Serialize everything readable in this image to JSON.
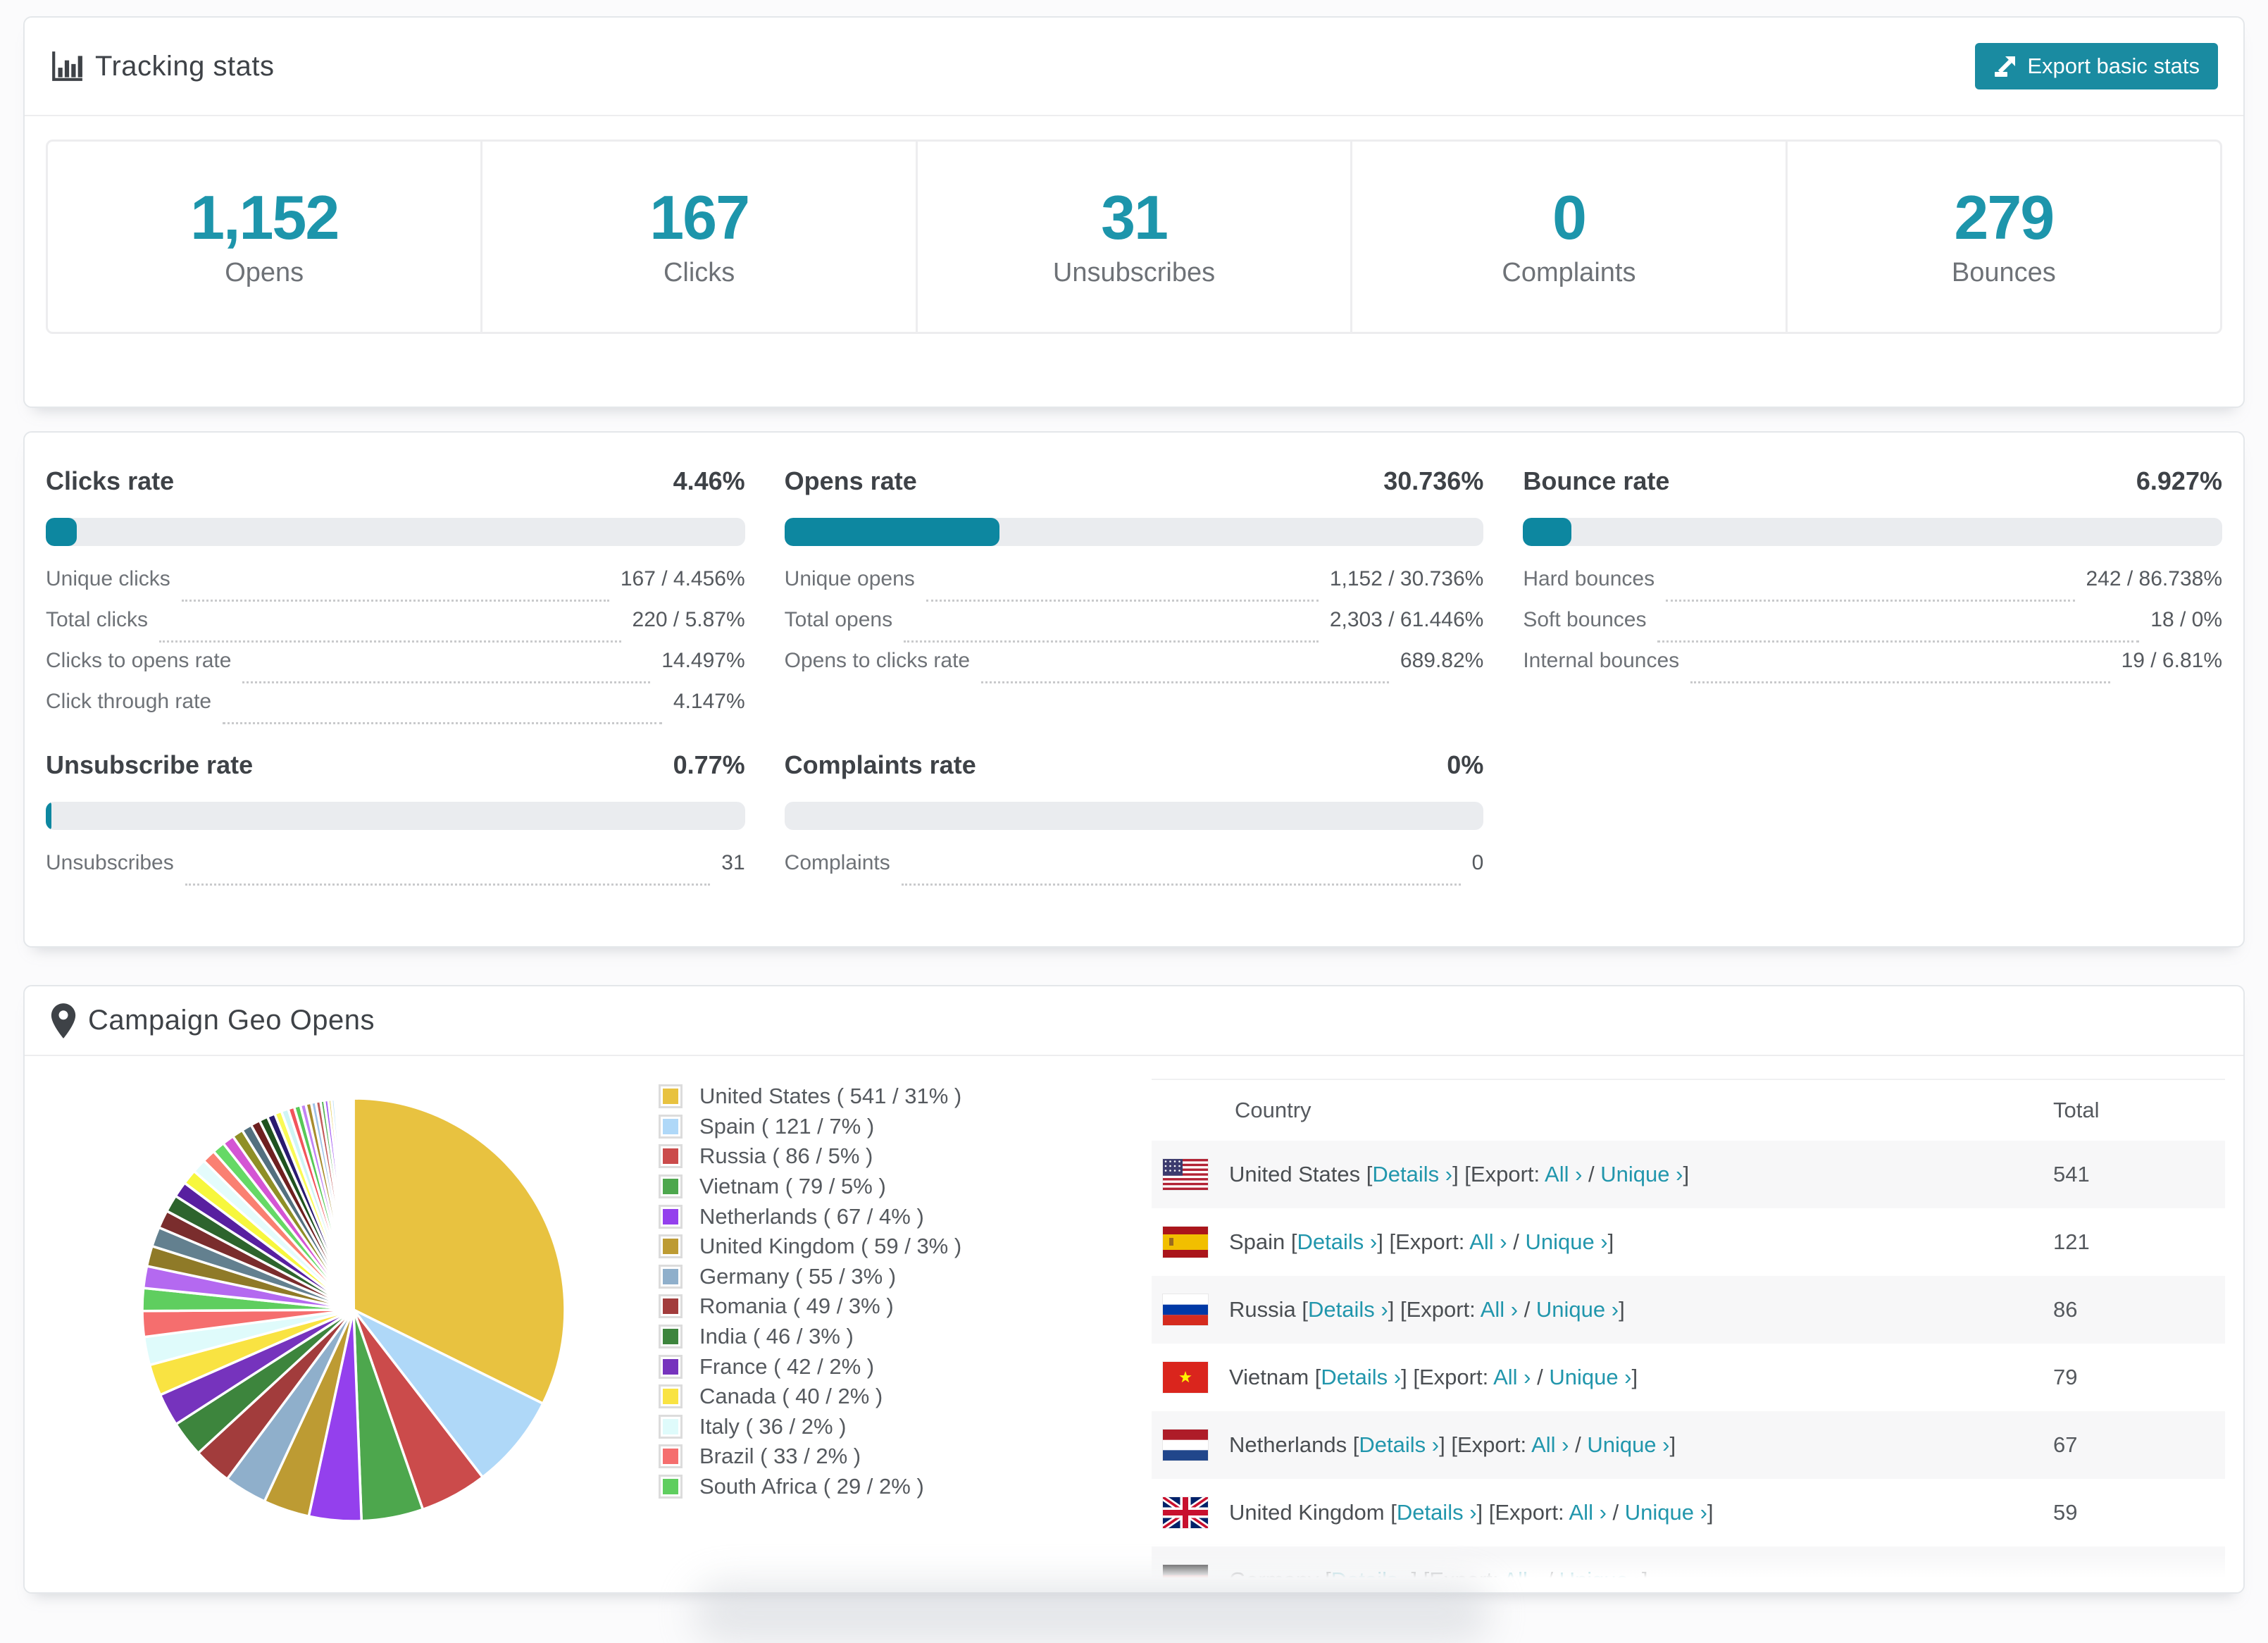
{
  "accent": {
    "teal_number": "#1d95ab",
    "teal_button": "#1a8ba1",
    "teal_link": "#2196ac",
    "bar_fill": "#0d87a0"
  },
  "tracking": {
    "title": "Tracking stats",
    "export_button": "Export basic stats",
    "stats": [
      {
        "value": "1,152",
        "label": "Opens"
      },
      {
        "value": "167",
        "label": "Clicks"
      },
      {
        "value": "31",
        "label": "Unsubscribes"
      },
      {
        "value": "0",
        "label": "Complaints"
      },
      {
        "value": "279",
        "label": "Bounces"
      }
    ]
  },
  "rates": {
    "blocks": [
      {
        "title": "Clicks rate",
        "value": "4.46%",
        "pct": 4.46,
        "rows": [
          {
            "label": "Unique clicks",
            "value": "167 / 4.456%"
          },
          {
            "label": "Total clicks",
            "value": "220 / 5.87%"
          },
          {
            "label": "Clicks to opens rate",
            "value": "14.497%"
          },
          {
            "label": "Click through rate",
            "value": "4.147%"
          }
        ]
      },
      {
        "title": "Opens rate",
        "value": "30.736%",
        "pct": 30.736,
        "rows": [
          {
            "label": "Unique opens",
            "value": "1,152 / 30.736%"
          },
          {
            "label": "Total opens",
            "value": "2,303 / 61.446%"
          },
          {
            "label": "Opens to clicks rate",
            "value": "689.82%"
          }
        ]
      },
      {
        "title": "Bounce rate",
        "value": "6.927%",
        "pct": 6.927,
        "rows": [
          {
            "label": "Hard bounces",
            "value": "242 / 86.738%"
          },
          {
            "label": "Soft bounces",
            "value": "18 / 0%"
          },
          {
            "label": "Internal bounces",
            "value": "19 / 6.81%"
          }
        ]
      },
      {
        "title": "Unsubscribe rate",
        "value": "0.77%",
        "pct": 0.77,
        "rows": [
          {
            "label": "Unsubscribes",
            "value": "31"
          }
        ]
      },
      {
        "title": "Complaints rate",
        "value": "0%",
        "pct": 0,
        "rows": [
          {
            "label": "Complaints",
            "value": "0"
          }
        ]
      }
    ]
  },
  "geo": {
    "title": "Campaign Geo Opens",
    "chart_data": {
      "type": "pie",
      "title": "Campaign Geo Opens",
      "legend_position": "right",
      "start_angle_deg": -90,
      "direction": "clockwise",
      "legend": [
        {
          "label": "United States ( 541 / 31% )",
          "country": "United States",
          "value": 541,
          "percent": 31,
          "color": "#E8C240"
        },
        {
          "label": "Spain ( 121 / 7% )",
          "country": "Spain",
          "value": 121,
          "percent": 7,
          "color": "#AFD8F8"
        },
        {
          "label": "Russia ( 86 / 5% )",
          "country": "Russia",
          "value": 86,
          "percent": 5,
          "color": "#CB4B4B"
        },
        {
          "label": "Vietnam ( 79 / 5% )",
          "country": "Vietnam",
          "value": 79,
          "percent": 5,
          "color": "#4DA74D"
        },
        {
          "label": "Netherlands ( 67 / 4% )",
          "country": "Netherlands",
          "value": 67,
          "percent": 4,
          "color": "#9440ED"
        },
        {
          "label": "United Kingdom ( 59 / 3% )",
          "country": "United Kingdom",
          "value": 59,
          "percent": 3,
          "color": "#BD9B33"
        },
        {
          "label": "Germany ( 55 / 3% )",
          "country": "Germany",
          "value": 55,
          "percent": 3,
          "color": "#8FAFCB"
        },
        {
          "label": "Romania ( 49 / 3% )",
          "country": "Romania",
          "value": 49,
          "percent": 3,
          "color": "#A23C3C"
        },
        {
          "label": "India ( 46 / 3% )",
          "country": "India",
          "value": 46,
          "percent": 3,
          "color": "#3D853D"
        },
        {
          "label": "France ( 42 / 2% )",
          "country": "France",
          "value": 42,
          "percent": 2,
          "color": "#7633BD"
        },
        {
          "label": "Canada ( 40 / 2% )",
          "country": "Canada",
          "value": 40,
          "percent": 2,
          "color": "#F9E342"
        },
        {
          "label": "Italy ( 36 / 2% )",
          "country": "Italy",
          "value": 36,
          "percent": 2,
          "color": "#DFFBFB"
        },
        {
          "label": "Brazil ( 33 / 2% )",
          "country": "Brazil",
          "value": 33,
          "percent": 2,
          "color": "#F56E6E"
        },
        {
          "label": "South Africa ( 29 / 2% )",
          "country": "South Africa",
          "value": 29,
          "percent": 2,
          "color": "#5FCE5F"
        }
      ],
      "estimated_tail": {
        "values": [
          28,
          26,
          25,
          23,
          22,
          20,
          19,
          18,
          17,
          16,
          15,
          14,
          13,
          12,
          11,
          10,
          9,
          9,
          8,
          8,
          7,
          7,
          6,
          6,
          5,
          5,
          4,
          4,
          3,
          3,
          3,
          2,
          2,
          2,
          2,
          1,
          1,
          1,
          1,
          1,
          1,
          1
        ],
        "colors": [
          "#B469F0",
          "#8F7A28",
          "#63808F",
          "#7A2D2D",
          "#2D642D",
          "#581FA0",
          "#F7F73D",
          "#E4FCFC",
          "#FA8072",
          "#66D966",
          "#D455D4",
          "#8F8F26",
          "#53707F",
          "#6E2020",
          "#1F521F",
          "#2A1A70",
          "#FAFA55",
          "#CFF5F5",
          "#F2545B",
          "#57C957",
          "#C083F5",
          "#A88C2E",
          "#9FC3E8",
          "#C25A5A",
          "#57B357",
          "#A35BF2",
          "#E0C84A",
          "#BBDFF8",
          "#D96A6A",
          "#6FBF6F",
          "#AA55EE",
          "#D1AE3C",
          "#A8CFF0",
          "#CC5555",
          "#66AA66",
          "#9944DD",
          "#EDD25A",
          "#C2E2F8",
          "#E57373",
          "#7FD67F",
          "#B977F2",
          "#D9BC4E"
        ]
      }
    },
    "table": {
      "col_country": "Country",
      "col_total": "Total",
      "details_label": "Details ›",
      "export_label": "Export:",
      "all_label": "All ›",
      "unique_label": "Unique ›",
      "rows": [
        {
          "country": "United States",
          "flag": "us-flag-icon",
          "total": "541"
        },
        {
          "country": "Spain",
          "flag": "es-flag-icon",
          "total": "121"
        },
        {
          "country": "Russia",
          "flag": "ru-flag-icon",
          "total": "86"
        },
        {
          "country": "Vietnam",
          "flag": "vn-flag-icon",
          "total": "79"
        },
        {
          "country": "Netherlands",
          "flag": "nl-flag-icon",
          "total": "67"
        },
        {
          "country": "United Kingdom",
          "flag": "gb-flag-icon",
          "total": "59"
        },
        {
          "country": "Germany",
          "flag": "de-flag-icon",
          "total": ""
        }
      ]
    }
  }
}
